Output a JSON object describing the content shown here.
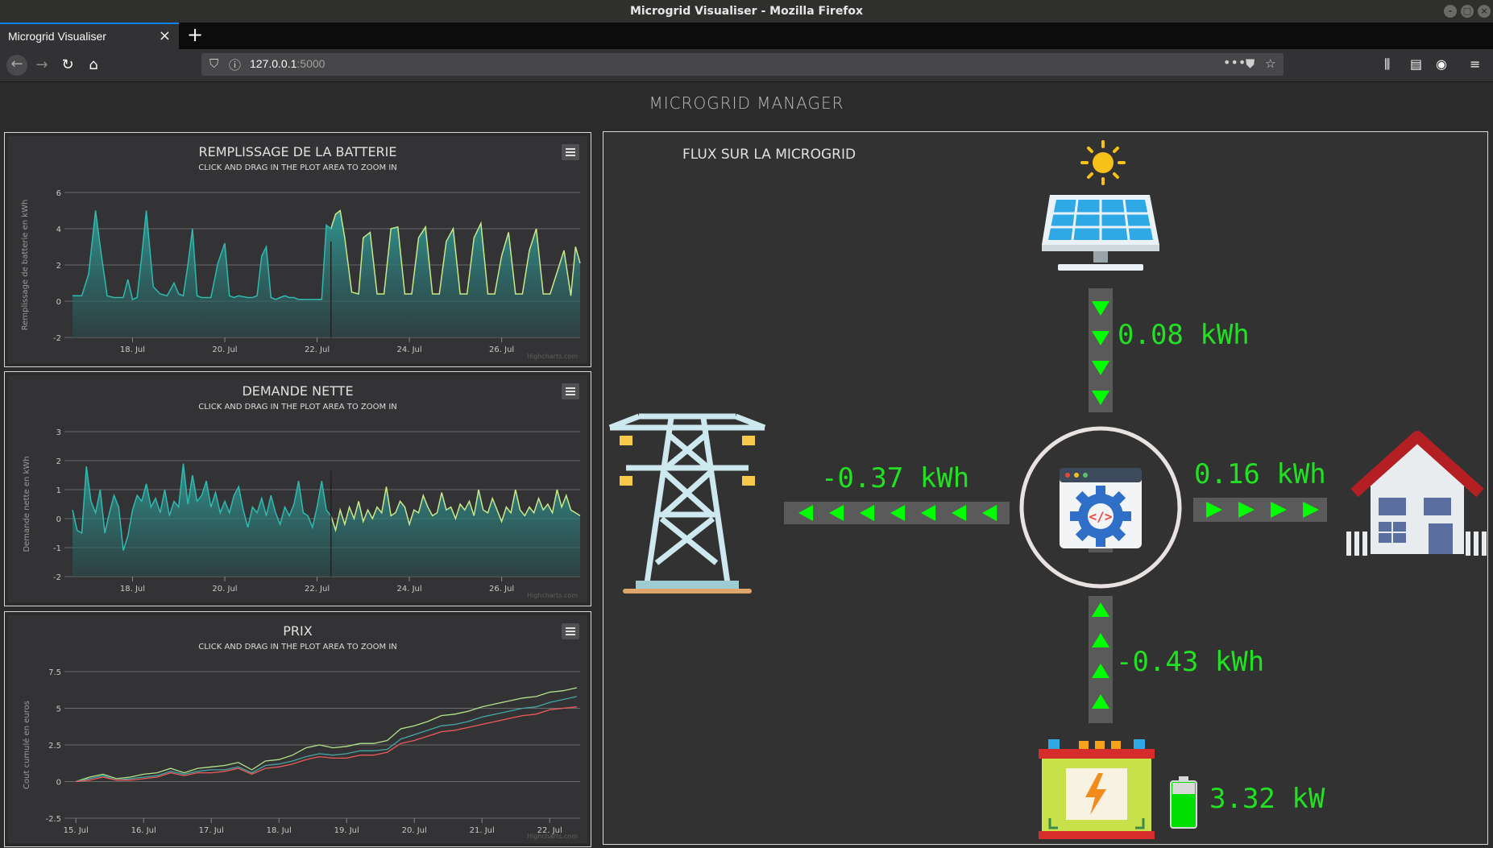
{
  "window": {
    "title": "Microgrid Visualiser - Mozilla Firefox"
  },
  "browser": {
    "tab_title": "Microgrid Visualiser",
    "url_host": "127.0.0.1",
    "url_port": ":5000"
  },
  "page": {
    "title": "MICROGRID MANAGER"
  },
  "charts": [
    {
      "title": "REMPLISSAGE DE LA BATTERIE",
      "subtitle": "CLICK AND DRAG IN THE PLOT AREA TO ZOOM IN",
      "ylabel": "Remplissage de batterie en kWh",
      "credit": "Highcharts.com"
    },
    {
      "title": "DEMANDE NETTE",
      "subtitle": "CLICK AND DRAG IN THE PLOT AREA TO ZOOM IN",
      "ylabel": "Demande nette en kWh",
      "credit": "Highcharts.com"
    },
    {
      "title": "PRIX",
      "subtitle": "CLICK AND DRAG IN THE PLOT AREA TO ZOOM IN",
      "ylabel": "Cout cumulé en euros",
      "credit": "Highcharts.com"
    }
  ],
  "chart_data": [
    {
      "type": "area",
      "title": "REMPLISSAGE DE LA BATTERIE",
      "subtitle": "CLICK AND DRAG IN THE PLOT AREA TO ZOOM IN",
      "ylabel": "Remplissage de batterie en kWh",
      "ylim": [
        -2,
        6
      ],
      "yticks": [
        6,
        4,
        2,
        0,
        -2
      ],
      "xlabels": [
        "18. Jul",
        "20. Jul",
        "22. Jul",
        "24. Jul",
        "26. Jul"
      ],
      "xlim": [
        16.7,
        27.7
      ],
      "xticks": [
        18,
        20,
        22,
        24,
        26
      ],
      "split_at": 22.3,
      "x": [
        16.7,
        16.9,
        17.05,
        17.2,
        17.3,
        17.45,
        17.6,
        17.8,
        17.9,
        18.0,
        18.1,
        18.2,
        18.3,
        18.45,
        18.6,
        18.75,
        18.9,
        19.0,
        19.1,
        19.2,
        19.3,
        19.4,
        19.5,
        19.6,
        19.7,
        19.85,
        20.0,
        20.1,
        20.2,
        20.3,
        20.5,
        20.6,
        20.7,
        20.8,
        20.9,
        21.0,
        21.1,
        21.2,
        21.3,
        21.4,
        21.5,
        21.6,
        21.7,
        21.8,
        21.95,
        22.1,
        22.2,
        22.3,
        22.4,
        22.5,
        22.6,
        22.75,
        22.9,
        23.0,
        23.15,
        23.3,
        23.45,
        23.6,
        23.75,
        23.9,
        24.05,
        24.2,
        24.35,
        24.5,
        24.65,
        24.8,
        24.95,
        25.1,
        25.25,
        25.4,
        25.55,
        25.7,
        25.85,
        26.0,
        26.15,
        26.3,
        26.45,
        26.6,
        26.75,
        26.9,
        27.05,
        27.2,
        27.35,
        27.5,
        27.6,
        27.7
      ],
      "y": [
        0.3,
        0.3,
        1.5,
        5.0,
        3.0,
        0.3,
        0.2,
        0.2,
        1.2,
        0.1,
        0.2,
        2.5,
        5.0,
        0.8,
        0.4,
        0.3,
        1.0,
        0.4,
        0.3,
        2.0,
        4.0,
        0.3,
        0.2,
        0.2,
        0.2,
        2.1,
        3.2,
        0.3,
        0.2,
        0.3,
        0.2,
        0.2,
        0.3,
        2.5,
        3.0,
        0.2,
        0.1,
        0.2,
        0.3,
        0.2,
        0.2,
        0.1,
        0.1,
        0.1,
        0.1,
        0.1,
        4.2,
        4.0,
        4.8,
        5.0,
        3.5,
        0.5,
        0.4,
        3.5,
        3.8,
        0.4,
        0.4,
        4.0,
        4.1,
        0.4,
        0.4,
        3.5,
        4.1,
        0.4,
        0.4,
        3.3,
        4.0,
        0.4,
        0.4,
        3.5,
        4.3,
        0.4,
        0.4,
        2.5,
        3.8,
        0.4,
        0.4,
        2.8,
        4.0,
        0.4,
        0.4,
        1.6,
        2.8,
        0.3,
        3.0,
        2.1
      ]
    },
    {
      "type": "area",
      "title": "DEMANDE NETTE",
      "subtitle": "CLICK AND DRAG IN THE PLOT AREA TO ZOOM IN",
      "ylabel": "Demande nette en kWh",
      "ylim": [
        -2,
        3
      ],
      "yticks": [
        3,
        2,
        1,
        0,
        -1,
        -2
      ],
      "xlabels": [
        "18. Jul",
        "20. Jul",
        "22. Jul",
        "24. Jul",
        "26. Jul"
      ],
      "xlim": [
        16.7,
        27.7
      ],
      "xticks": [
        18,
        20,
        22,
        24,
        26
      ],
      "split_at": 22.3,
      "x": [
        16.7,
        16.8,
        16.9,
        17.0,
        17.1,
        17.2,
        17.3,
        17.4,
        17.5,
        17.6,
        17.7,
        17.8,
        17.9,
        18.0,
        18.1,
        18.2,
        18.3,
        18.4,
        18.5,
        18.6,
        18.7,
        18.8,
        18.9,
        19.0,
        19.1,
        19.2,
        19.3,
        19.4,
        19.5,
        19.6,
        19.7,
        19.8,
        19.9,
        20.0,
        20.1,
        20.2,
        20.3,
        20.4,
        20.5,
        20.6,
        20.7,
        20.8,
        20.9,
        21.0,
        21.1,
        21.2,
        21.3,
        21.4,
        21.5,
        21.6,
        21.7,
        21.8,
        21.9,
        22.0,
        22.1,
        22.2,
        22.3,
        22.4,
        22.5,
        22.6,
        22.7,
        22.8,
        22.9,
        23.0,
        23.1,
        23.2,
        23.3,
        23.4,
        23.5,
        23.6,
        23.7,
        23.8,
        23.9,
        24.0,
        24.1,
        24.2,
        24.3,
        24.4,
        24.5,
        24.6,
        24.7,
        24.8,
        24.9,
        25.0,
        25.1,
        25.2,
        25.3,
        25.4,
        25.5,
        25.6,
        25.7,
        25.8,
        25.9,
        26.0,
        26.1,
        26.2,
        26.3,
        26.4,
        26.5,
        26.6,
        26.7,
        26.8,
        26.9,
        27.0,
        27.1,
        27.2,
        27.3,
        27.4,
        27.5,
        27.6,
        27.7
      ],
      "y": [
        0.3,
        -0.4,
        -0.5,
        1.8,
        0.6,
        0.2,
        1.0,
        -0.5,
        0.2,
        0.8,
        0.4,
        -1.1,
        -0.6,
        0.3,
        0.8,
        0.6,
        1.2,
        0.4,
        0.7,
        0.2,
        1.0,
        0.1,
        0.6,
        0.4,
        1.9,
        0.5,
        1.5,
        0.6,
        0.8,
        1.3,
        0.4,
        0.9,
        0.2,
        0.6,
        0.2,
        0.8,
        1.1,
        0.3,
        -0.3,
        0.4,
        0.2,
        0.7,
        0.1,
        0.8,
        0.2,
        -0.2,
        0.4,
        0.1,
        0.5,
        1.3,
        0.2,
        0.1,
        -0.3,
        0.4,
        1.3,
        0.3,
        0.1,
        -0.4,
        0.3,
        -0.2,
        0.4,
        0.0,
        0.6,
        -0.1,
        0.3,
        0.0,
        0.4,
        0.2,
        1.1,
        0.1,
        0.2,
        0.6,
        0.4,
        -0.2,
        0.3,
        0.2,
        0.8,
        0.4,
        0.1,
        0.2,
        0.9,
        0.3,
        0.4,
        0.0,
        0.5,
        0.3,
        0.6,
        0.1,
        1.0,
        0.3,
        0.2,
        0.7,
        0.3,
        -0.1,
        0.4,
        0.2,
        1.0,
        0.3,
        0.1,
        0.4,
        0.2,
        0.7,
        0.3,
        0.5,
        0.2,
        1.0,
        0.4,
        0.8,
        0.3,
        0.2,
        0.1
      ]
    },
    {
      "type": "line",
      "title": "PRIX",
      "subtitle": "CLICK AND DRAG IN THE PLOT AREA TO ZOOM IN",
      "ylabel": "Cout cumulé en euros",
      "ylim": [
        -2.5,
        7.5
      ],
      "yticks": [
        7.5,
        5,
        2.5,
        0,
        -2.5
      ],
      "xlabels": [
        "15. Jul",
        "16. Jul",
        "17. Jul",
        "18. Jul",
        "19. Jul",
        "20. Jul",
        "21. Jul",
        "22. Jul"
      ],
      "xlim": [
        14.95,
        22.45
      ],
      "xticks": [
        15,
        16,
        17,
        18,
        19,
        20,
        21,
        22
      ],
      "x": [
        15.0,
        15.2,
        15.4,
        15.6,
        15.8,
        16.0,
        16.2,
        16.4,
        16.6,
        16.8,
        17.0,
        17.2,
        17.4,
        17.6,
        17.8,
        18.0,
        18.2,
        18.4,
        18.6,
        18.8,
        19.0,
        19.2,
        19.4,
        19.6,
        19.8,
        20.0,
        20.2,
        20.4,
        20.6,
        20.8,
        21.0,
        21.2,
        21.4,
        21.6,
        21.8,
        22.0,
        22.2,
        22.4
      ],
      "series": [
        {
          "color": "#b4e38a",
          "values": [
            0.0,
            0.3,
            0.5,
            0.2,
            0.3,
            0.5,
            0.6,
            0.9,
            0.6,
            0.9,
            1.0,
            1.1,
            1.3,
            0.8,
            1.4,
            1.5,
            1.8,
            2.3,
            2.5,
            2.3,
            2.4,
            2.6,
            2.6,
            2.8,
            3.6,
            3.8,
            4.1,
            4.5,
            4.6,
            4.8,
            5.1,
            5.3,
            5.5,
            5.7,
            5.8,
            6.1,
            6.2,
            6.4
          ]
        },
        {
          "color": "#46a6a6",
          "values": [
            0.0,
            0.2,
            0.4,
            0.1,
            0.2,
            0.3,
            0.4,
            0.7,
            0.5,
            0.7,
            0.8,
            0.8,
            1.0,
            0.6,
            1.1,
            1.2,
            1.4,
            1.7,
            1.9,
            1.8,
            1.9,
            2.1,
            2.1,
            2.2,
            2.9,
            3.2,
            3.5,
            3.8,
            3.9,
            4.1,
            4.4,
            4.6,
            4.8,
            5.0,
            5.1,
            5.4,
            5.6,
            5.8
          ]
        },
        {
          "color": "#ee5a5a",
          "values": [
            0.0,
            0.1,
            0.3,
            0.1,
            0.1,
            0.2,
            0.3,
            0.6,
            0.4,
            0.6,
            0.6,
            0.7,
            0.9,
            0.5,
            0.9,
            1.0,
            1.2,
            1.5,
            1.7,
            1.6,
            1.6,
            1.8,
            1.8,
            2.0,
            2.6,
            2.8,
            3.1,
            3.4,
            3.5,
            3.7,
            3.9,
            4.1,
            4.3,
            4.5,
            4.6,
            4.9,
            5.0,
            5.1
          ]
        }
      ]
    }
  ],
  "flux": {
    "title": "FLUX SUR LA MICROGRID",
    "solar_value": "0.08 kWh",
    "grid_value": "-0.37 kWh",
    "house_value": "0.16 kWh",
    "battery_flow_value": "-0.43 kWh",
    "battery_level": "3.32 kW",
    "arrow_color": "#00ff00",
    "flow_text_color": "#22e022"
  }
}
